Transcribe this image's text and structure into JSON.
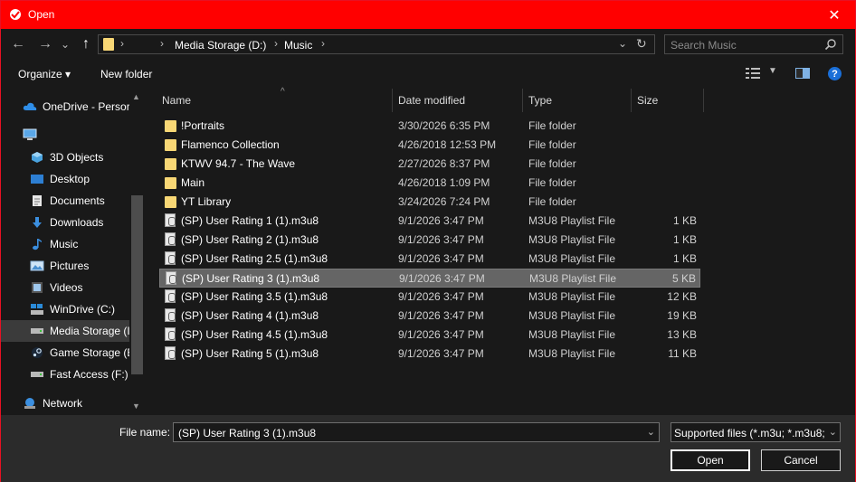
{
  "window": {
    "title": "Open",
    "close_glyph": "✕"
  },
  "nav": {
    "back_glyph": "←",
    "forward_glyph": "→",
    "recent_glyph": "⌄",
    "up_glyph": "↑",
    "breadcrumb": [
      "Media Storage (D:)",
      "Music"
    ],
    "sep_glyph": "›",
    "dropdown_glyph": "⌄",
    "refresh_glyph": "↻"
  },
  "search": {
    "placeholder": "Search Music"
  },
  "toolbar": {
    "organize_label": "Organize ▾",
    "new_folder_label": "New folder",
    "view_dropdown_glyph": "▼",
    "help_glyph": "?"
  },
  "sidebar": {
    "items": [
      {
        "label": "OneDrive - Persor",
        "icon": "onedrive-icon"
      },
      {
        "label": "",
        "icon": "this-pc-icon"
      },
      {
        "label": "3D Objects",
        "icon": "3d-objects-icon"
      },
      {
        "label": "Desktop",
        "icon": "desktop-icon"
      },
      {
        "label": "Documents",
        "icon": "documents-icon"
      },
      {
        "label": "Downloads",
        "icon": "downloads-icon"
      },
      {
        "label": "Music",
        "icon": "music-icon"
      },
      {
        "label": "Pictures",
        "icon": "pictures-icon"
      },
      {
        "label": "Videos",
        "icon": "videos-icon"
      },
      {
        "label": "WinDrive (C:)",
        "icon": "drive-icon"
      },
      {
        "label": "Media Storage (I",
        "icon": "drive-icon"
      },
      {
        "label": "Game Storage (E",
        "icon": "steam-icon"
      },
      {
        "label": "Fast Access (F:)",
        "icon": "drive-icon"
      },
      {
        "label": "Network",
        "icon": "network-icon"
      }
    ],
    "scroll_up_glyph": "▲",
    "scroll_down_glyph": "▼"
  },
  "columns": {
    "name": "Name",
    "date": "Date modified",
    "type": "Type",
    "size": "Size",
    "sort_glyph": "^"
  },
  "files": [
    {
      "name": "!Portraits",
      "date": "3/30/2026 6:35 PM",
      "type": "File folder",
      "size": "",
      "kind": "folder"
    },
    {
      "name": "Flamenco Collection",
      "date": "4/26/2018 12:53 PM",
      "type": "File folder",
      "size": "",
      "kind": "folder"
    },
    {
      "name": "KTWV 94.7 - The Wave",
      "date": "2/27/2026 8:37 PM",
      "type": "File folder",
      "size": "",
      "kind": "folder"
    },
    {
      "name": "Main",
      "date": "4/26/2018 1:09 PM",
      "type": "File folder",
      "size": "",
      "kind": "folder"
    },
    {
      "name": "YT Library",
      "date": "3/24/2026 7:24 PM",
      "type": "File folder",
      "size": "",
      "kind": "folder"
    },
    {
      "name": "(SP) User Rating 1 (1).m3u8",
      "date": "9/1/2026 3:47 PM",
      "type": "M3U8 Playlist File",
      "size": "1 KB",
      "kind": "file"
    },
    {
      "name": "(SP) User Rating 2 (1).m3u8",
      "date": "9/1/2026 3:47 PM",
      "type": "M3U8 Playlist File",
      "size": "1 KB",
      "kind": "file"
    },
    {
      "name": "(SP) User Rating 2.5 (1).m3u8",
      "date": "9/1/2026 3:47 PM",
      "type": "M3U8 Playlist File",
      "size": "1 KB",
      "kind": "file"
    },
    {
      "name": "(SP) User Rating 3 (1).m3u8",
      "date": "9/1/2026 3:47 PM",
      "type": "M3U8 Playlist File",
      "size": "5 KB",
      "kind": "file"
    },
    {
      "name": "(SP) User Rating 3.5 (1).m3u8",
      "date": "9/1/2026 3:47 PM",
      "type": "M3U8 Playlist File",
      "size": "12 KB",
      "kind": "file"
    },
    {
      "name": "(SP) User Rating 4 (1).m3u8",
      "date": "9/1/2026 3:47 PM",
      "type": "M3U8 Playlist File",
      "size": "19 KB",
      "kind": "file"
    },
    {
      "name": "(SP) User Rating 4.5 (1).m3u8",
      "date": "9/1/2026 3:47 PM",
      "type": "M3U8 Playlist File",
      "size": "13 KB",
      "kind": "file"
    },
    {
      "name": "(SP) User Rating 5 (1).m3u8",
      "date": "9/1/2026 3:47 PM",
      "type": "M3U8 Playlist File",
      "size": "11 KB",
      "kind": "file"
    }
  ],
  "selected_file_index": 8,
  "selected_sidebar_index": 10,
  "footer": {
    "filename_label": "File name:",
    "filename_value": "(SP) User Rating 3 (1).m3u8",
    "filter_value": "Supported files (*.m3u; *.m3u8;",
    "dropdown_glyph": "⌄",
    "open_label": "Open",
    "cancel_label": "Cancel"
  },
  "colors": {
    "titlebar": "#ff0000",
    "background": "#191919",
    "selection": "#656565",
    "folder": "#f8d775",
    "accent": "#1a6fd8"
  }
}
